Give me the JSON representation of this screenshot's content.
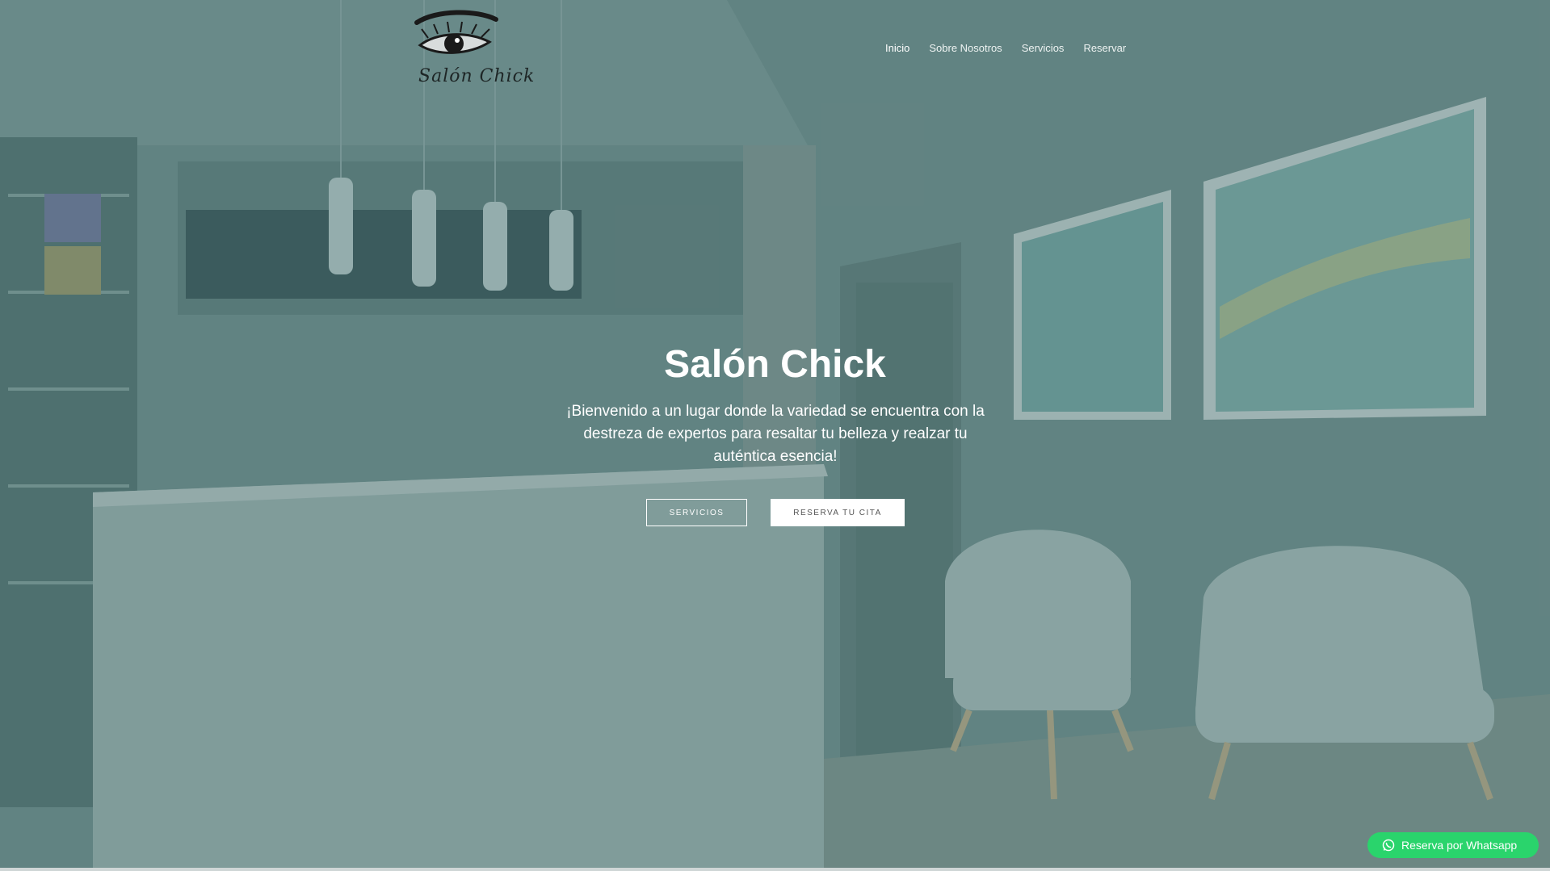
{
  "brand": {
    "logo_text": "Salón Chick"
  },
  "nav": {
    "items": [
      {
        "label": "Inicio",
        "active": true
      },
      {
        "label": "Sobre Nosotros"
      },
      {
        "label": "Servicios"
      },
      {
        "label": "Reservar"
      }
    ]
  },
  "hero": {
    "title": "Salón Chick",
    "subtitle": "¡Bienvenido a un lugar donde la variedad se encuentra con la destreza de expertos para resaltar tu belleza y realzar tu auténtica esencia!",
    "buttons": {
      "services": "SERVICIOS",
      "book": "RESERVA TU CITA"
    }
  },
  "whatsapp": {
    "label": "Reserva por Whatsapp",
    "icon": "whatsapp-icon",
    "color": "#2ad46c"
  },
  "colors": {
    "overlay": "#345e5e",
    "accent": "#2ad46c"
  }
}
